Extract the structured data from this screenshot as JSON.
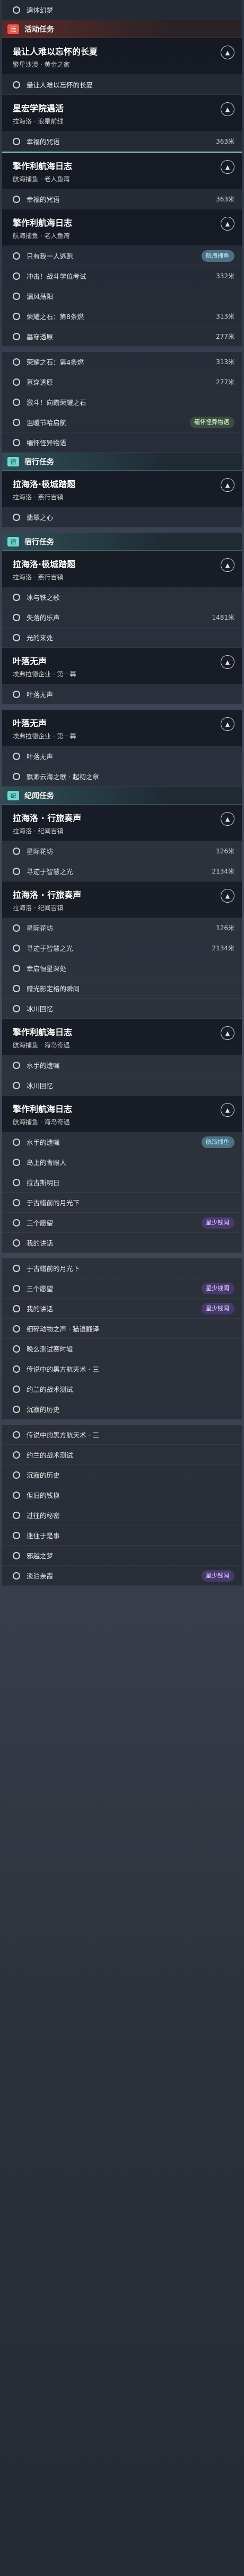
{
  "rows": [
    {
      "kind": "row",
      "name": "quest-row",
      "text": "遍体幻梦"
    },
    {
      "kind": "sect",
      "cls": "red",
      "badge": "活",
      "label": "活动任务"
    },
    {
      "kind": "head",
      "t": "最让人难以忘怀的长夏",
      "s": "繁星沙漠 · 黄金之家"
    },
    {
      "kind": "row",
      "text": "最让人难以忘怀的长夏"
    },
    {
      "kind": "head",
      "t": "星宏学院遇活",
      "s": "拉海洛 · 浪星前线"
    },
    {
      "kind": "row",
      "text": "幸福的咒语",
      "dist": "363米"
    },
    {
      "kind": "head",
      "t": "擎作利航海日志",
      "s": "航海捕鱼 · 老人鱼湾",
      "hl": true
    },
    {
      "kind": "row",
      "text": "幸福的咒语",
      "dist": "363米"
    },
    {
      "kind": "head",
      "t": "擎作利航海日志",
      "s": "航海捕鱼 · 老人鱼湾"
    },
    {
      "kind": "row",
      "text": "只有我一人逃跑",
      "tag": "航海捕鱼",
      "tagc": "teal"
    },
    {
      "kind": "row",
      "text": "冲击！战斗学位考试",
      "dist": "332米"
    },
    {
      "kind": "row",
      "text": "漏风荡阳"
    },
    {
      "kind": "row",
      "text": "荣耀之石：第8条燃",
      "dist": "313米"
    },
    {
      "kind": "row",
      "text": "墓穿透原",
      "dist": "277米"
    },
    {
      "kind": "gap"
    },
    {
      "kind": "row",
      "text": "荣耀之石：第4条燃",
      "dist": "313米"
    },
    {
      "kind": "row",
      "text": "墓穿透原",
      "dist": "277米"
    },
    {
      "kind": "row",
      "text": "激斗！向霸荣耀之石"
    },
    {
      "kind": "row",
      "text": "温暖节哈启航",
      "tag": "缅怀怪异物语",
      "tagc": "green"
    },
    {
      "kind": "row",
      "text": "缅怀怪异物语"
    },
    {
      "kind": "sect",
      "cls": "teal",
      "badge": "宿",
      "label": "宿行任务"
    },
    {
      "kind": "head",
      "t": "拉海洛·极城踏题",
      "s": "拉海洛 · 燕行吉镇"
    },
    {
      "kind": "row",
      "text": "翡翠之心"
    },
    {
      "kind": "gap"
    },
    {
      "kind": "sect",
      "cls": "teal",
      "badge": "宿",
      "label": "宿行任务"
    },
    {
      "kind": "head",
      "t": "拉海洛·极城踏题",
      "s": "拉海洛 · 燕行吉镇"
    },
    {
      "kind": "row",
      "text": "冰与铁之歌"
    },
    {
      "kind": "row",
      "text": "失落的乐声",
      "dist": "1481米"
    },
    {
      "kind": "row",
      "text": "光的来处"
    },
    {
      "kind": "head",
      "t": "叶落无声",
      "s": "埃弗拉德企业 · 第一幕"
    },
    {
      "kind": "row",
      "text": "叶落无声"
    },
    {
      "kind": "gap"
    },
    {
      "kind": "head",
      "t": "叶落无声",
      "s": "埃弗拉德企业 · 第一幕"
    },
    {
      "kind": "row",
      "text": "叶落无声"
    },
    {
      "kind": "row",
      "text": "飘渺云海之歌 · 起初之章"
    },
    {
      "kind": "sect",
      "cls": "teal",
      "badge": "纪",
      "label": "纪闻任务"
    },
    {
      "kind": "head",
      "t": "拉海洛 · 行旅奏声",
      "s": "拉海洛 · 纪闻吉镇"
    },
    {
      "kind": "row",
      "text": "星际花坊",
      "dist": "126米"
    },
    {
      "kind": "row",
      "text": "寻迹于智慧之光",
      "dist": "2134米"
    },
    {
      "kind": "head",
      "t": "拉海洛 · 行旅奏声",
      "s": "拉海洛 · 纪闻吉镇"
    },
    {
      "kind": "row",
      "text": "星际花坊",
      "dist": "126米"
    },
    {
      "kind": "row",
      "text": "寻迹于智慧之光",
      "dist": "2134米"
    },
    {
      "kind": "row",
      "text": "幸启恒星深处"
    },
    {
      "kind": "row",
      "text": "赠光影定格的瞬间"
    },
    {
      "kind": "row",
      "text": "冰川回忆"
    },
    {
      "kind": "head",
      "t": "擎作利航海日志",
      "s": "航海捕鱼 · 海岛奇遇"
    },
    {
      "kind": "row",
      "text": "水手的遗嘱"
    },
    {
      "kind": "row",
      "text": "冰川回忆"
    },
    {
      "kind": "head",
      "t": "擎作利航海日志",
      "s": "航海捕鱼 · 海岛奇遇"
    },
    {
      "kind": "row",
      "text": "水手的遗嘱",
      "tag": "航海捕鱼",
      "tagc": "teal"
    },
    {
      "kind": "row",
      "text": "岛上的青眼人"
    },
    {
      "kind": "row",
      "text": "拉古斯明日"
    },
    {
      "kind": "row",
      "text": "于古蜡前的月光下"
    },
    {
      "kind": "row",
      "text": "三个愿望",
      "tag": "星少钱闻",
      "tagc": "purple"
    },
    {
      "kind": "row",
      "text": "我的讲话"
    },
    {
      "kind": "gap"
    },
    {
      "kind": "row",
      "text": "于古蜡前的月光下"
    },
    {
      "kind": "row",
      "text": "三个愿望",
      "tag": "星少钱闻",
      "tagc": "purple"
    },
    {
      "kind": "row",
      "text": "我的讲话",
      "tag": "星少钱闻",
      "tagc": "purple"
    },
    {
      "kind": "row",
      "text": "细碎动物之声 · 猫语翻译"
    },
    {
      "kind": "row",
      "text": "晚么测试赛时辑"
    },
    {
      "kind": "row",
      "text": "传说中的黑方航天术 · 三"
    },
    {
      "kind": "row",
      "text": "约兰的战术测试"
    },
    {
      "kind": "row",
      "text": "沉寂的历史"
    },
    {
      "kind": "gap"
    },
    {
      "kind": "row",
      "text": "传说中的黑方航天术 · 三"
    },
    {
      "kind": "row",
      "text": "约兰的战术测试"
    },
    {
      "kind": "row",
      "text": "沉寂的历史"
    },
    {
      "kind": "row",
      "text": "但旧的钱换"
    },
    {
      "kind": "row",
      "text": "过往的秘密"
    },
    {
      "kind": "row",
      "text": "迷住于是事"
    },
    {
      "kind": "row",
      "text": "邪越之梦"
    },
    {
      "kind": "row",
      "text": "淡泊奈霞",
      "tag": "星少钱闻",
      "tagc": "purple"
    }
  ]
}
